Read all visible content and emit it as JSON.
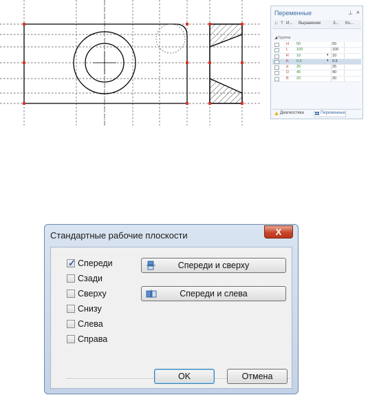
{
  "variables_panel": {
    "title": "Переменные",
    "pin_icon": "pin-icon",
    "close_glyph": "×",
    "columns": [
      "?",
      "И...",
      "Выражение",
      "З...",
      "Ко..."
    ],
    "group_label": "Группа",
    "rows": [
      {
        "name": "H",
        "expression": "50",
        "value": "50"
      },
      {
        "name": "L",
        "expression": "100",
        "value": "100"
      },
      {
        "name": "R",
        "expression": "10",
        "value": "10"
      },
      {
        "name": "K",
        "expression": "0.5",
        "value": "0.5"
      },
      {
        "name": "d",
        "expression": "25",
        "value": "25"
      },
      {
        "name": "D",
        "expression": "40",
        "value": "40"
      },
      {
        "name": "B",
        "expression": "20",
        "value": "20"
      }
    ],
    "selected_row": 3,
    "tabs": [
      "Диагностика",
      "Переменные"
    ]
  },
  "dialog": {
    "title": "Стандартные рабочие плоскости",
    "close_glyph": "X",
    "checkboxes": [
      {
        "label": "Спереди",
        "checked": true
      },
      {
        "label": "Сзади",
        "checked": false
      },
      {
        "label": "Сверху",
        "checked": false
      },
      {
        "label": "Снизу",
        "checked": false
      },
      {
        "label": "Слева",
        "checked": false
      },
      {
        "label": "Справа",
        "checked": false
      }
    ],
    "check_glyph": "✓",
    "front_top_button": "Спереди и сверху",
    "front_left_button": "Спереди и слева",
    "ok_button": "OK",
    "cancel_button": "Отмена"
  },
  "colors": {
    "accent": "#3c6aa5",
    "red_marker": "#d9342b",
    "close_red": "#c9452b"
  }
}
